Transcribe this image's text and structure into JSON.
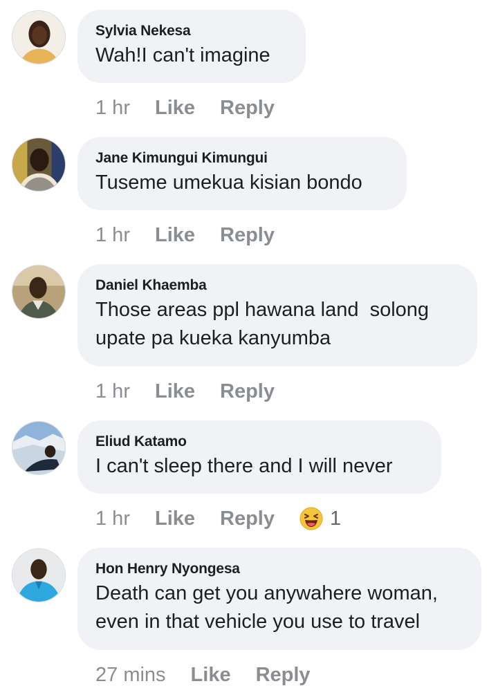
{
  "comments": [
    {
      "name": "Sylvia Nekesa",
      "text": "Wah!I can't imagine",
      "time": "1 hr",
      "like": "Like",
      "reply": "Reply"
    },
    {
      "name": "Jane Kimungui Kimungui",
      "text": "Tuseme umekua kisian bondo",
      "time": "1 hr",
      "like": "Like",
      "reply": "Reply"
    },
    {
      "name": "Daniel Khaemba",
      "text": "Those areas ppl hawana land  solong upate pa kueka kanyumba",
      "time": "1 hr",
      "like": "Like",
      "reply": "Reply"
    },
    {
      "name": "Eliud Katamo",
      "text": "I can't sleep there and I will never",
      "time": "1 hr",
      "like": "Like",
      "reply": "Reply",
      "reaction": {
        "icon": "laughing-emoji-icon",
        "count": "1"
      }
    },
    {
      "name": "Hon Henry Nyongesa",
      "text": "Death can get you anywahere woman, even in that vehicle you use to travel",
      "time": "27 mins",
      "like": "Like",
      "reply": "Reply"
    }
  ]
}
